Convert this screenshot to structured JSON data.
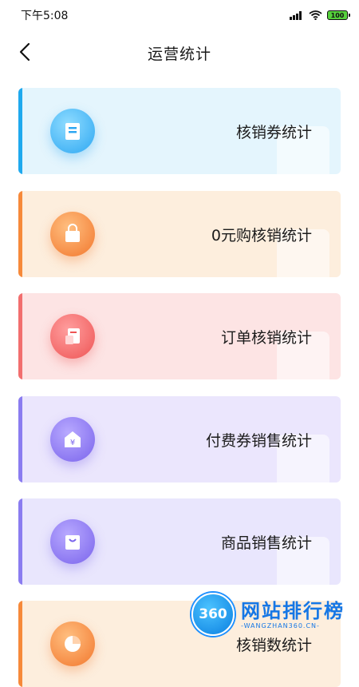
{
  "status_bar": {
    "time": "下午5:08",
    "battery": "100"
  },
  "nav": {
    "title": "运营统计"
  },
  "cards": [
    {
      "label": "核销券统计",
      "icon": "voucher-icon"
    },
    {
      "label": "0元购核销统计",
      "icon": "shopping-bag-icon"
    },
    {
      "label": "订单核销统计",
      "icon": "order-icon"
    },
    {
      "label": "付费券销售统计",
      "icon": "yuan-coupon-icon"
    },
    {
      "label": "商品销售统计",
      "icon": "product-bag-icon"
    },
    {
      "label": "核销数统计",
      "icon": "pie-chart-icon"
    }
  ],
  "watermark": {
    "badge": "360",
    "title": "网站排行榜",
    "subtitle": "-WANGZHAN360.CN-"
  },
  "colors": {
    "blue": "#1fa9ee",
    "orange": "#f6893a",
    "red": "#f26e6e",
    "purple": "#8a7cf0"
  }
}
